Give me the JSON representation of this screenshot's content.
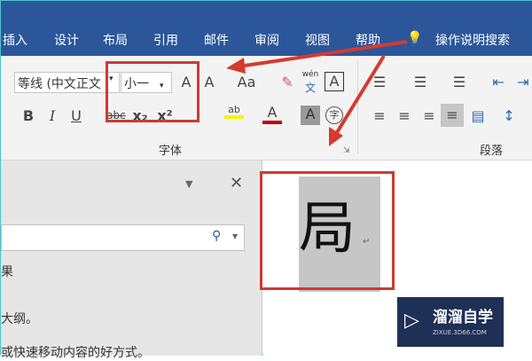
{
  "tabs": [
    "插入",
    "设计",
    "布局",
    "引用",
    "邮件",
    "审阅",
    "视图",
    "帮助"
  ],
  "tell_me": "操作说明搜索",
  "font": {
    "name": "等线 (中文正文",
    "size": "小一",
    "group_label": "字体"
  },
  "paragraph": {
    "group_label": "段落"
  },
  "buttons": {
    "grow": "A",
    "shrink": "A",
    "case": "Aa",
    "pinyin_top": "wén",
    "pinyin": "文",
    "border_char": "A",
    "bold": "B",
    "italic": "I",
    "underline": "U",
    "strike": "abc",
    "sub": "x₂",
    "sup": "x²",
    "font_color": "A",
    "shade": "A",
    "circle": "字",
    "highlight": "ab"
  },
  "nav": {
    "partial1": "果",
    "partial2": "大纲。",
    "partial3": "或快速移动内容的好方式。"
  },
  "doc": {
    "char": "局",
    "mark": "↵"
  },
  "watermark": {
    "name": "溜溜自学",
    "url": "ZIXUE.3D66.COM"
  },
  "colors": {
    "accent": "#2b579a",
    "highlight": "#cc3b33"
  }
}
